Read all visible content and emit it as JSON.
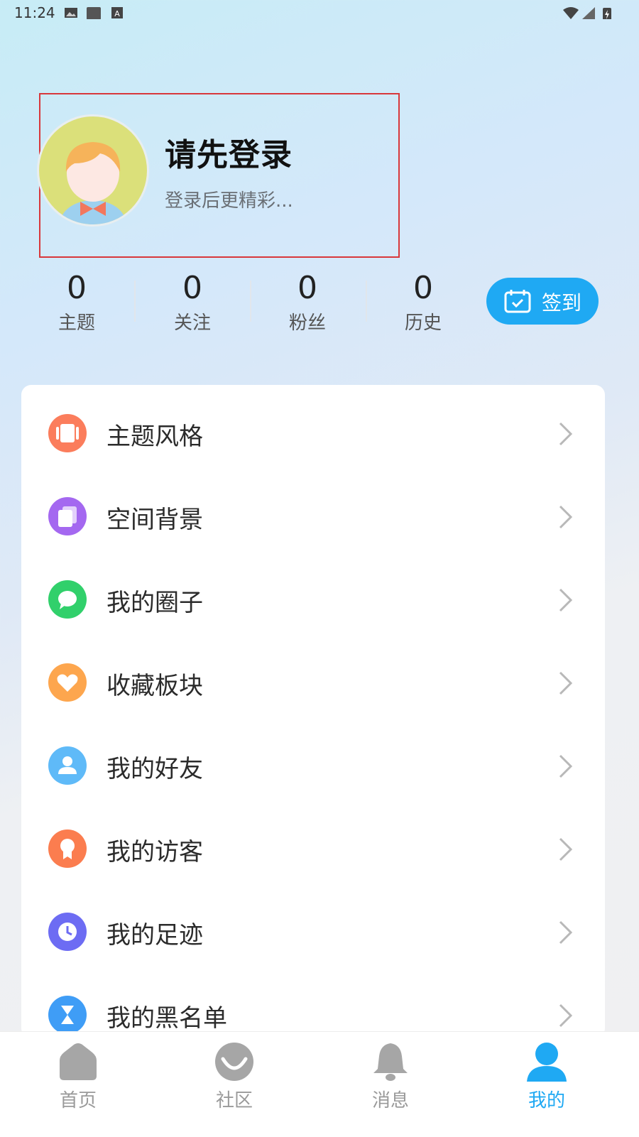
{
  "status_bar": {
    "time": "11:24"
  },
  "profile": {
    "title": "请先登录",
    "subtitle": "登录后更精彩..."
  },
  "stats": [
    {
      "value": "0",
      "label": "主题"
    },
    {
      "value": "0",
      "label": "关注"
    },
    {
      "value": "0",
      "label": "粉丝"
    },
    {
      "value": "0",
      "label": "历史"
    }
  ],
  "checkin": {
    "label": "签到",
    "icon": "calendar-check-icon"
  },
  "menu": [
    {
      "label": "主题风格",
      "icon": "theme-style-icon",
      "color": "#fb7d5c"
    },
    {
      "label": "空间背景",
      "icon": "background-icon",
      "color": "#a468f0"
    },
    {
      "label": "我的圈子",
      "icon": "circle-chat-icon",
      "color": "#31d06b"
    },
    {
      "label": "收藏板块",
      "icon": "heart-icon",
      "color": "#fda64e"
    },
    {
      "label": "我的好友",
      "icon": "friend-icon",
      "color": "#5fbaf8"
    },
    {
      "label": "我的访客",
      "icon": "visitor-icon",
      "color": "#fb7d4f"
    },
    {
      "label": "我的足迹",
      "icon": "clock-icon",
      "color": "#6d6cf3"
    },
    {
      "label": "我的黑名单",
      "icon": "hourglass-icon",
      "color": "#3f9df6"
    }
  ],
  "bottom_nav": [
    {
      "label": "首页",
      "icon": "home-icon",
      "active": false
    },
    {
      "label": "社区",
      "icon": "community-icon",
      "active": false
    },
    {
      "label": "消息",
      "icon": "bell-icon",
      "active": false
    },
    {
      "label": "我的",
      "icon": "person-icon",
      "active": true
    }
  ],
  "colors": {
    "accent": "#1fa9f3",
    "highlight_box": "#d8373b",
    "nav_inactive": "#9a9a9a"
  }
}
